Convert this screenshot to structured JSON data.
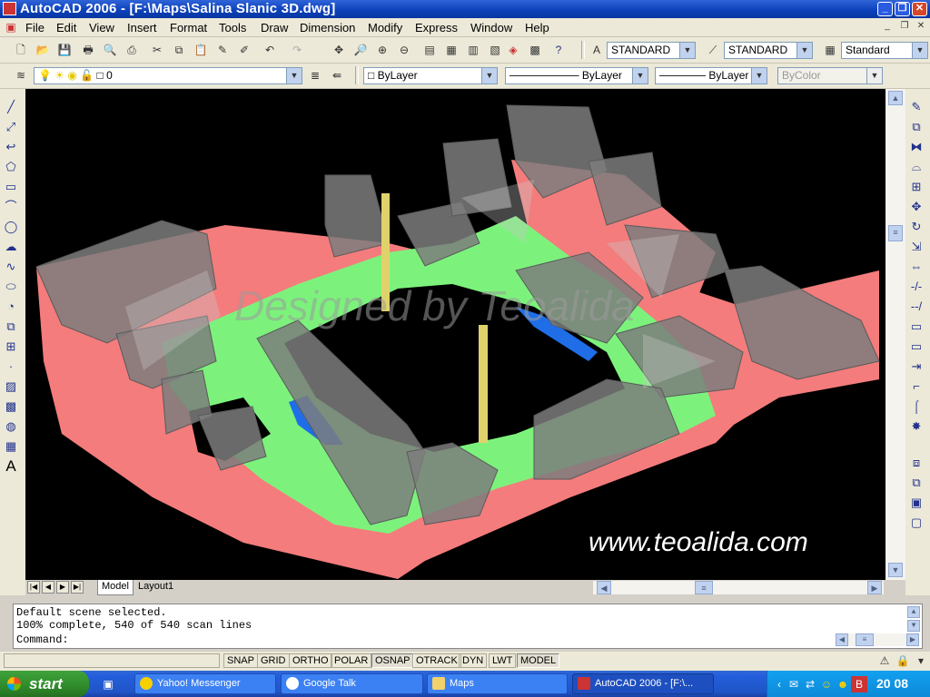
{
  "window": {
    "title": "AutoCAD 2006 - [F:\\Maps\\Salina Slanic 3D.dwg]"
  },
  "menu": [
    "File",
    "Edit",
    "View",
    "Insert",
    "Format",
    "Tools",
    "Draw",
    "Dimension",
    "Modify",
    "Express",
    "Window",
    "Help"
  ],
  "styles_toolbar": {
    "text_style": "STANDARD",
    "dim_style": "STANDARD",
    "table_style": "Standard"
  },
  "layers_toolbar": {
    "current_layer": "0"
  },
  "properties_toolbar": {
    "color": "ByLayer",
    "linetype": "ByLayer",
    "lineweight": "ByLayer",
    "plot_style": "ByColor"
  },
  "viewport": {
    "watermark": "Designed by Teoalida",
    "website": "www.teoalida.com",
    "colors": {
      "background": "#000000",
      "ground": "#f47c7c",
      "grass": "#7cf27c",
      "water": "#1f6ee8",
      "buildings": "#8a8a8a",
      "pillar": "#e0d26a"
    }
  },
  "layout_tabs": [
    {
      "label": "Model",
      "active": true
    },
    {
      "label": "Layout1",
      "active": false
    }
  ],
  "command_history": [
    "Default scene selected.",
    "100% complete, 540 of 540 scan lines"
  ],
  "command_prompt": "Command:",
  "status_toggles": [
    {
      "label": "SNAP",
      "on": false
    },
    {
      "label": "GRID",
      "on": false
    },
    {
      "label": "ORTHO",
      "on": false
    },
    {
      "label": "POLAR",
      "on": false
    },
    {
      "label": "OSNAP",
      "on": true
    },
    {
      "label": "OTRACK",
      "on": false
    },
    {
      "label": "DYN",
      "on": false
    },
    {
      "label": "LWT",
      "on": false
    },
    {
      "label": "MODEL",
      "on": true
    }
  ],
  "taskbar": {
    "start_label": "start",
    "buttons": [
      {
        "label": "Yahoo! Messenger",
        "active": false
      },
      {
        "label": "Google Talk",
        "active": false
      },
      {
        "label": "Maps",
        "active": false
      },
      {
        "label": "AutoCAD 2006 - [F:\\...",
        "active": true
      }
    ],
    "clock": "20 08"
  }
}
